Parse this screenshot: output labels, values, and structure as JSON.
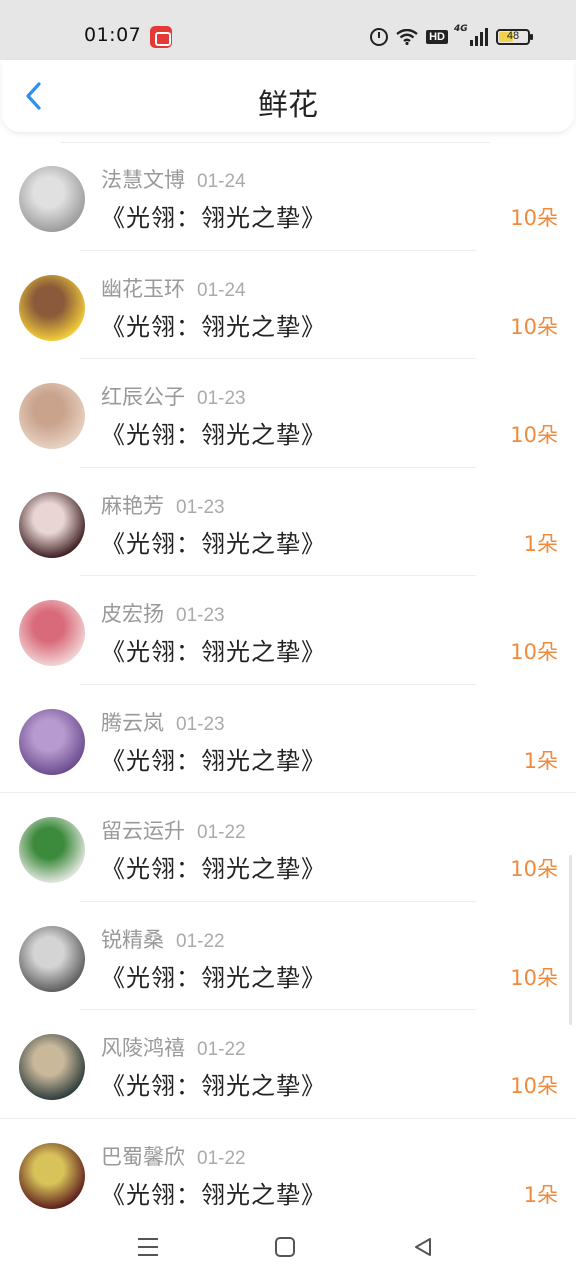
{
  "status_bar": {
    "time": "01:07",
    "battery": "48",
    "network": "4G",
    "hd_label": "HD"
  },
  "header": {
    "title": "鲜花",
    "back_icon": "chevron-left-icon",
    "accent_color": "#2e8ff0"
  },
  "list": {
    "count_color": "#f08a3c",
    "items": [
      {
        "name": "法慧文博",
        "date": "01-24",
        "book": "《光翎：翎光之挚》",
        "count": "10朵",
        "avatar_colors": [
          "#9a9a9a",
          "#e0e0e0"
        ]
      },
      {
        "name": "幽花玉环",
        "date": "01-24",
        "book": "《光翎：翎光之挚》",
        "count": "10朵",
        "avatar_colors": [
          "#f6d03a",
          "#8a5a3a"
        ]
      },
      {
        "name": "红辰公子",
        "date": "01-23",
        "book": "《光翎：翎光之挚》",
        "count": "10朵",
        "avatar_colors": [
          "#e8d3c4",
          "#c9a38c"
        ]
      },
      {
        "name": "麻艳芳",
        "date": "01-23",
        "book": "《光翎：翎光之挚》",
        "count": "1朵",
        "avatar_colors": [
          "#3a1a1e",
          "#e9d6d4"
        ]
      },
      {
        "name": "皮宏扬",
        "date": "01-23",
        "book": "《光翎：翎光之挚》",
        "count": "10朵",
        "avatar_colors": [
          "#f2d7d7",
          "#d96a7a"
        ]
      },
      {
        "name": "腾云岚",
        "date": "01-23",
        "book": "《光翎：翎光之挚》",
        "count": "1朵",
        "avatar_colors": [
          "#6a4a8c",
          "#b79bd0"
        ]
      },
      {
        "name": "留云运升",
        "date": "01-22",
        "book": "《光翎：翎光之挚》",
        "count": "10朵",
        "avatar_colors": [
          "#e8eae4",
          "#3c8a3c"
        ]
      },
      {
        "name": "锐精桑",
        "date": "01-22",
        "book": "《光翎：翎光之挚》",
        "count": "10朵",
        "avatar_colors": [
          "#5a5a5a",
          "#d4d4d4"
        ]
      },
      {
        "name": "风陵鸿禧",
        "date": "01-22",
        "book": "《光翎：翎光之挚》",
        "count": "10朵",
        "avatar_colors": [
          "#2a3a3a",
          "#c9b89a"
        ]
      },
      {
        "name": "巴蜀馨欣",
        "date": "01-22",
        "book": "《光翎：翎光之挚》",
        "count": "1朵",
        "avatar_colors": [
          "#5a1a1a",
          "#d8c25a"
        ]
      }
    ]
  },
  "nav_bar": {
    "menu_icon": "menu-icon",
    "home_icon": "home-square-icon",
    "back_icon": "back-triangle-icon"
  }
}
